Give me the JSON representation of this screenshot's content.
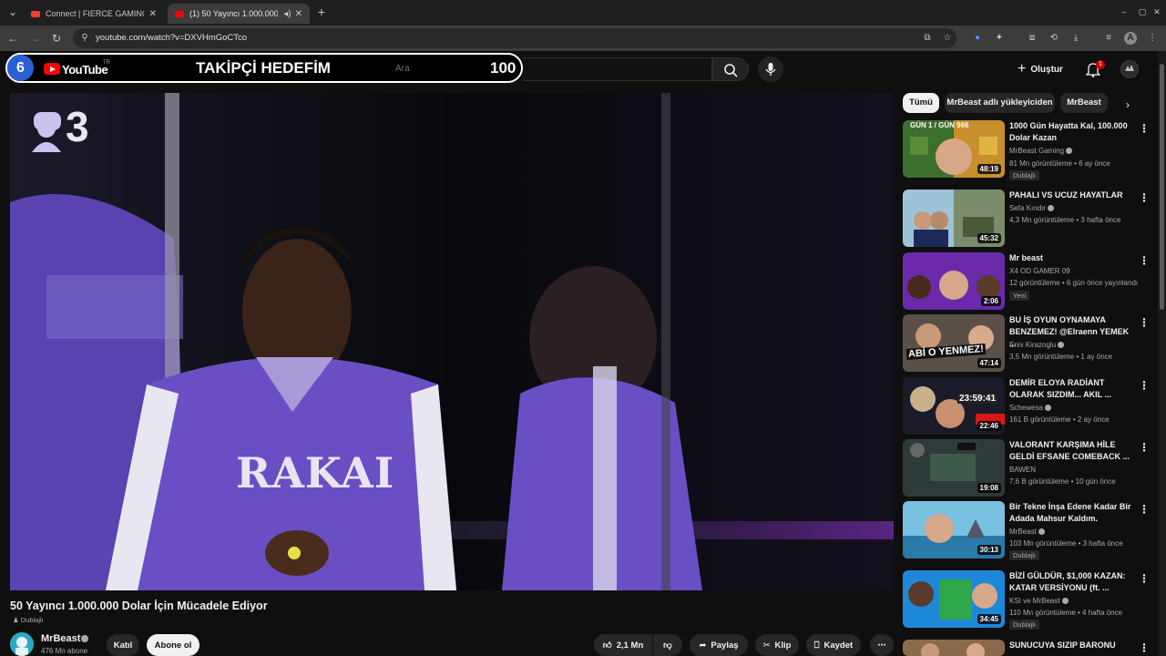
{
  "browser": {
    "tabs": [
      {
        "title": "Connect | FIERCE GAMING"
      },
      {
        "title": "(1) 50 Yayıncı 1.000.000 Dol"
      }
    ],
    "url": "youtube.com/watch?v=DXVHmGoCTco",
    "new_tab": "+",
    "profile_initial": "A"
  },
  "overlay": {
    "number": "6",
    "title": "TAKİPÇİ HEDEFİM",
    "count": "100"
  },
  "header": {
    "logo_text": "YouTube",
    "logo_region": "TR",
    "search_placeholder": "Ara",
    "create_label": "Oluştur",
    "notif_count": "1"
  },
  "video": {
    "title": "50 Yayıncı 1.000.000 Dolar İçin Mücadele Ediyor",
    "dub_label": "Dublajlı",
    "jersey_text": "RAKAI",
    "stream_count": "3",
    "channel": "MrBeast",
    "subscribers": "476 Mn abone",
    "join_label": "Katıl",
    "subscribe_label": "Abone ol",
    "likes": "2,1 Mn",
    "share_label": "Paylaş",
    "clip_label": "Klip",
    "save_label": "Kaydet"
  },
  "sidebar": {
    "chips": [
      "Tümü",
      "MrBeast adlı yükleyiciden",
      "MrBeast"
    ],
    "recommendations": [
      {
        "title": "1000 Gün Hayatta Kal, 100.000 Dolar Kazan",
        "channel": "MrBeast Gaming",
        "verified": true,
        "meta": "81 Mn görüntüleme • 6 ay önce",
        "badge": "Dublajlı",
        "duration": "48:19",
        "thumb_text": "GÜN 1 / GÜN 966"
      },
      {
        "title": "PAHALI VS UCUZ HAYATLAR",
        "channel": "Sefa Kındır",
        "verified": true,
        "meta": "4,3 Mn görüntüleme • 3 hafta önce",
        "badge": "",
        "duration": "45:32",
        "thumb_text": ""
      },
      {
        "title": "Mr beast",
        "channel": "X4 OD GAMER 09",
        "verified": false,
        "meta": "12 görüntüleme • 6 gün önce yayınlandı",
        "badge": "Yeni",
        "duration": "2:06",
        "thumb_text": ""
      },
      {
        "title": "BU İŞ OYUN OYNAMAYA BENZEMEZ! @Elraenn YEMEK ...",
        "channel": "Enis Kirazoglu",
        "verified": true,
        "meta": "3,5 Mn görüntüleme • 1 ay önce",
        "badge": "",
        "duration": "47:14",
        "thumb_text": "ABİ O YENMEZ!"
      },
      {
        "title": "DEMİR ELOYA RADİANT OLARAK SIZDIM... AKIL ...",
        "channel": "Schewesa",
        "verified": true,
        "meta": "161 B görüntüleme • 2 ay önce",
        "badge": "",
        "duration": "22:46",
        "thumb_text": "23:59:41"
      },
      {
        "title": "VALORANT KARŞIMA HİLE GELDİ EFSANE COMEBACK ...",
        "channel": "BAWEN",
        "verified": false,
        "meta": "7,6 B görüntüleme • 10 gün önce",
        "badge": "",
        "duration": "19:08",
        "thumb_text": ""
      },
      {
        "title": "Bir Tekne İnşa Edene Kadar Bir Adada Mahsur Kaldım.",
        "channel": "MrBeast",
        "verified": true,
        "meta": "103 Mn görüntüleme • 3 hafta önce",
        "badge": "Dublajlı",
        "duration": "30:13",
        "thumb_text": ""
      },
      {
        "title": "BİZİ GÜLDÜR, $1,000 KAZAN: KATAR VERSİYONU (ft. ...",
        "channel": "KSI ve MrBeast",
        "verified": true,
        "meta": "110 Mn görüntüleme • 4 hafta önce",
        "badge": "Dublajlı",
        "duration": "34:45",
        "thumb_text": ""
      },
      {
        "title": "SUNUCUYA SIZIP BARONU",
        "channel": "",
        "verified": false,
        "meta": "",
        "badge": "",
        "duration": "",
        "thumb_text": ""
      }
    ]
  },
  "colors": {
    "background": "#0f0f0f",
    "accent_red": "#ff0000",
    "jersey_purple": "#6a4fc4",
    "overlay_blue": "#2a5fd6"
  }
}
